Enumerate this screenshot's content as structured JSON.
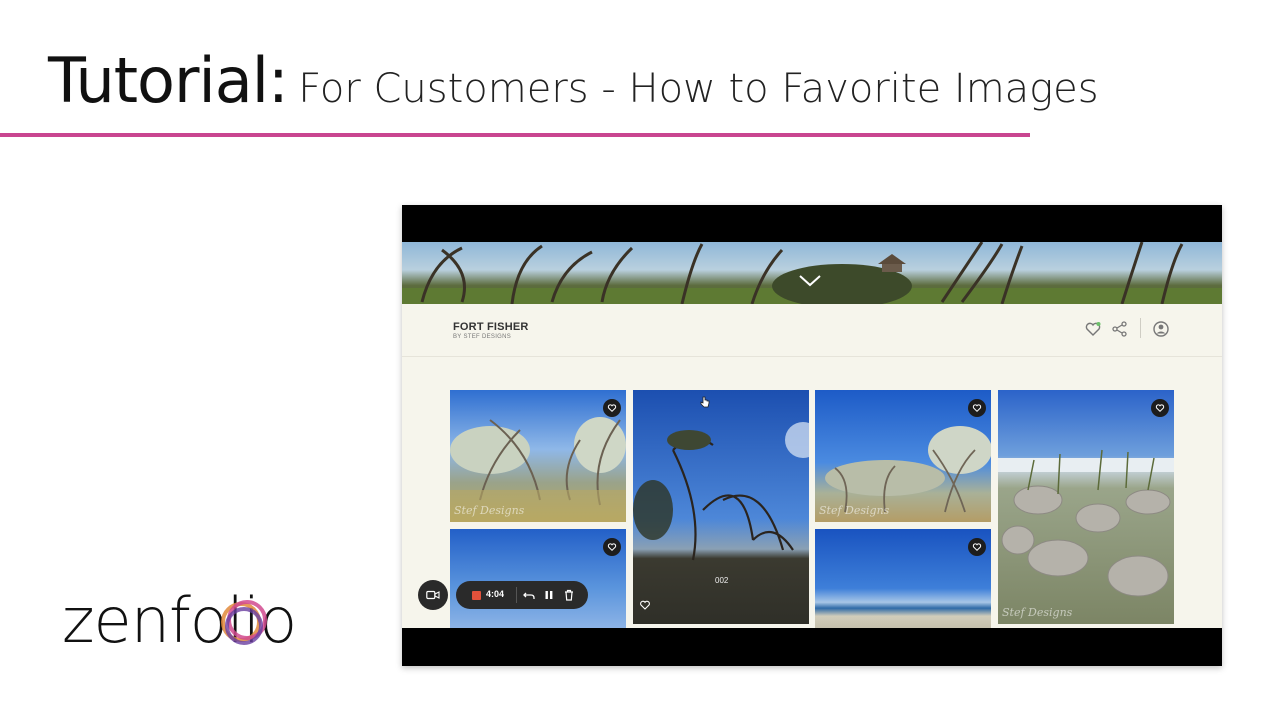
{
  "slide": {
    "title_main": "Tutorial:",
    "title_sub": "For Customers - How to Favorite Images",
    "accent_color": "#c94590"
  },
  "logo": {
    "text": "zenfolio"
  },
  "gallery": {
    "title": "FORT FISHER",
    "byline": "BY STEF DESIGNS",
    "header_icons": [
      "heart-icon",
      "share-icon",
      "account-icon"
    ],
    "banner_icon": "chevron-down-icon",
    "images": [
      {
        "name": "trees-wind",
        "watermark": "Stef Designs",
        "favorite_icon": "heart-icon"
      },
      {
        "name": "twisted-tree",
        "number": "002",
        "favorite_icon": "heart-icon"
      },
      {
        "name": "live-oaks",
        "watermark": "Stef Designs",
        "favorite_icon": "heart-icon"
      },
      {
        "name": "dunes-rocks",
        "watermark": "Stef Designs",
        "favorite_icon": "heart-icon"
      },
      {
        "name": "blue-sky",
        "favorite_icon": "heart-icon"
      },
      {
        "name": "beach-sky",
        "favorite_icon": "heart-icon"
      }
    ]
  },
  "recorder": {
    "time": "4:04",
    "icons": [
      "camera-icon",
      "stop-icon",
      "undo-icon",
      "pause-icon",
      "trash-icon"
    ]
  }
}
